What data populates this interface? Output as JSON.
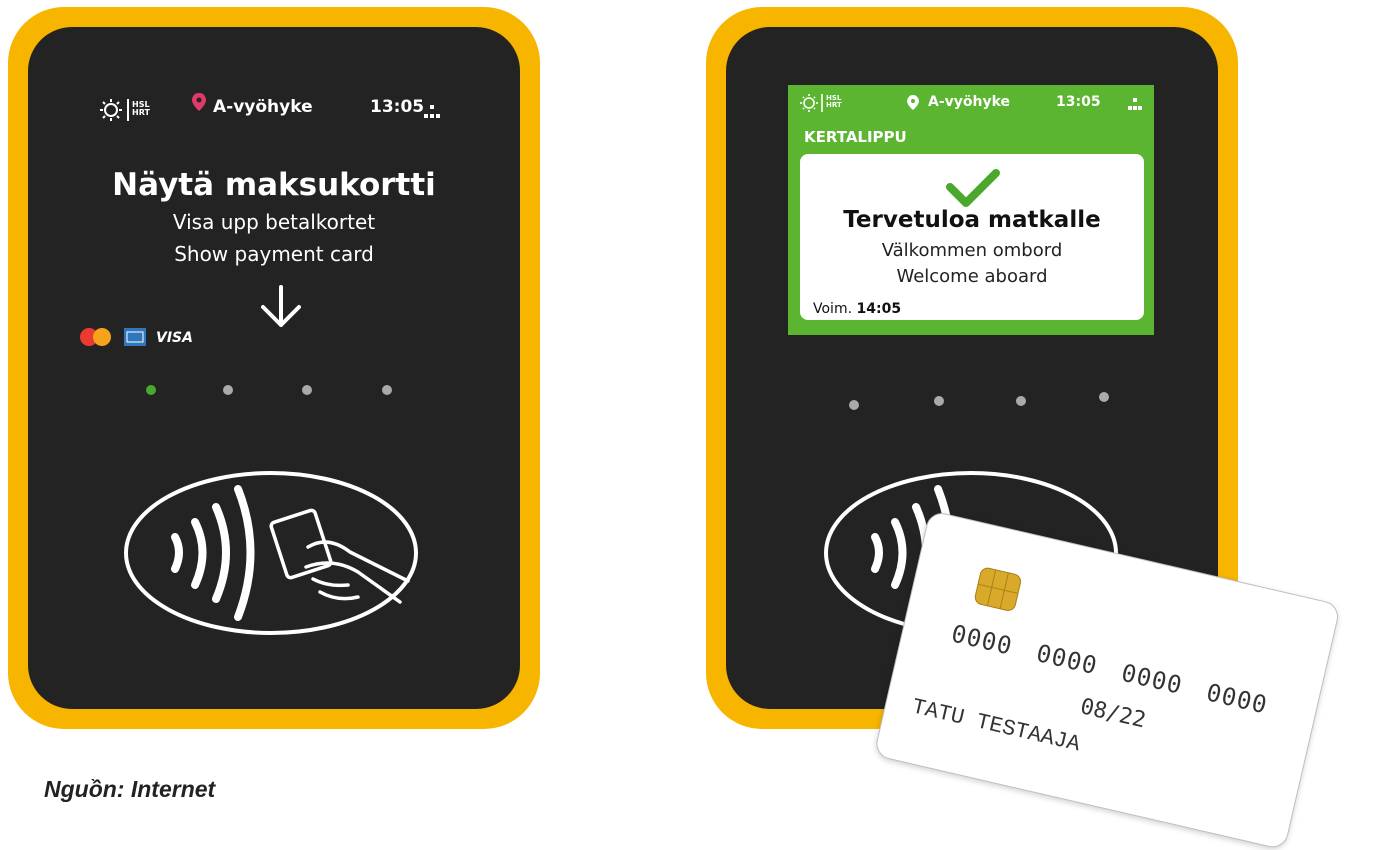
{
  "left_reader": {
    "zone": "A-vyöhyke",
    "time": "13:05",
    "title": "Näytä maksukortti",
    "line2": "Visa upp betalkortet",
    "line3": "Show payment card",
    "brand_hsl": "HSL HRT",
    "card_brands": [
      "mastercard-icon",
      "amex-icon",
      "VISA"
    ],
    "visa_label": "VISA"
  },
  "right_reader": {
    "zone": "A-vyöhyke",
    "time": "13:05",
    "brand_hsl": "HSL HRT",
    "ticket_type": "KERTALIPPU",
    "title": "Tervetuloa matkalle",
    "line2": "Välkommen ombord",
    "line3": "Welcome aboard",
    "valid_label": "Voim.",
    "valid_time": "14:05"
  },
  "payment_card": {
    "number": "0000 0000 0000 0000",
    "expiry": "08/22",
    "holder": "TATU TESTAAJA"
  },
  "caption": "Nguồn: Internet",
  "colors": {
    "frame": "#f7b500",
    "body": "#232323",
    "screen_green": "#5bb531",
    "check_green": "#4aa82e",
    "pin_pink": "#e03a6b"
  }
}
